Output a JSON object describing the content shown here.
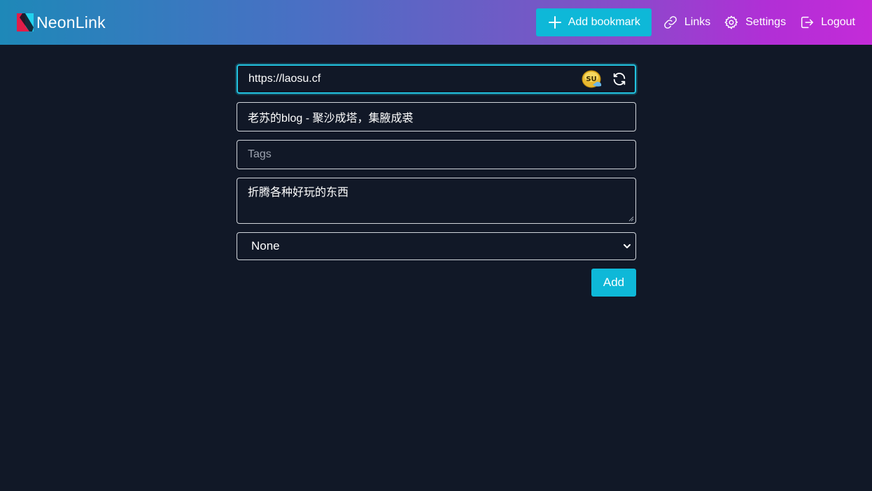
{
  "brand": {
    "name": "NeonLink"
  },
  "nav": {
    "add_bookmark": "Add bookmark",
    "links": "Links",
    "settings": "Settings",
    "logout": "Logout"
  },
  "form": {
    "url_value": "https://laosu.cf",
    "title_value": "老苏的blog - 聚沙成塔，集腋成裘",
    "tags_placeholder": "Tags",
    "description_value": "折腾各种好玩的东西",
    "category_selected": "None",
    "submit_label": "Add"
  },
  "favicon": {
    "text": "SU"
  },
  "colors": {
    "background": "#111827",
    "accent": "#0eb8d8",
    "gradient_start": "#1e88b8",
    "gradient_end": "#c42bd8"
  }
}
